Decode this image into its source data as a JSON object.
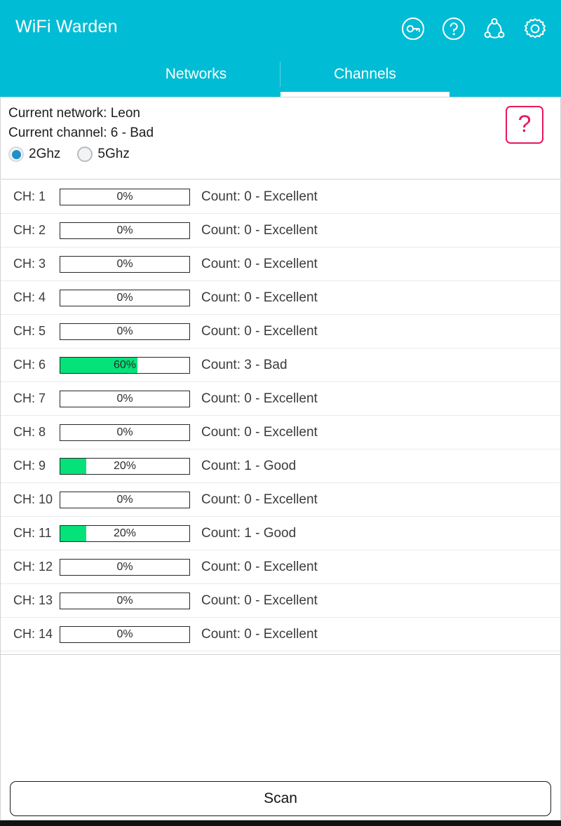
{
  "header": {
    "title": "WiFi Warden",
    "background": "#00bcd4",
    "icons": [
      {
        "name": "key-circle-icon",
        "label": "Passwords"
      },
      {
        "name": "question-circle-icon",
        "label": "Help"
      },
      {
        "name": "network-nodes-icon",
        "label": "Connections"
      },
      {
        "name": "gear-icon",
        "label": "Settings"
      }
    ]
  },
  "tabs": {
    "items": [
      {
        "label": "Networks",
        "active": false
      },
      {
        "label": "Channels",
        "active": true
      }
    ]
  },
  "info": {
    "current_network": "Current network: Leon",
    "current_channel": "Current channel: 6 - Bad",
    "help_glyph": "?",
    "help_color": "#e8195b",
    "bands": [
      {
        "label": "2Ghz",
        "selected": true
      },
      {
        "label": "5Ghz",
        "selected": false
      }
    ]
  },
  "channels": {
    "rows": [
      {
        "label": "CH: 1",
        "percent": "0%",
        "fill": 0,
        "count": "Count: 0 - Excellent"
      },
      {
        "label": "CH: 2",
        "percent": "0%",
        "fill": 0,
        "count": "Count: 0 - Excellent"
      },
      {
        "label": "CH: 3",
        "percent": "0%",
        "fill": 0,
        "count": "Count: 0 - Excellent"
      },
      {
        "label": "CH: 4",
        "percent": "0%",
        "fill": 0,
        "count": "Count: 0 - Excellent"
      },
      {
        "label": "CH: 5",
        "percent": "0%",
        "fill": 0,
        "count": "Count: 0 - Excellent"
      },
      {
        "label": "CH: 6",
        "percent": "60%",
        "fill": 60,
        "count": "Count: 3 - Bad"
      },
      {
        "label": "CH: 7",
        "percent": "0%",
        "fill": 0,
        "count": "Count: 0 - Excellent"
      },
      {
        "label": "CH: 8",
        "percent": "0%",
        "fill": 0,
        "count": "Count: 0 - Excellent"
      },
      {
        "label": "CH: 9",
        "percent": "20%",
        "fill": 20,
        "count": "Count: 1 - Good"
      },
      {
        "label": "CH: 10",
        "percent": "0%",
        "fill": 0,
        "count": "Count: 0 - Excellent"
      },
      {
        "label": "CH: 11",
        "percent": "20%",
        "fill": 20,
        "count": "Count: 1 - Good"
      },
      {
        "label": "CH: 12",
        "percent": "0%",
        "fill": 0,
        "count": "Count: 0 - Excellent"
      },
      {
        "label": "CH: 13",
        "percent": "0%",
        "fill": 0,
        "count": "Count: 0 - Excellent"
      },
      {
        "label": "CH: 14",
        "percent": "0%",
        "fill": 0,
        "count": "Count: 0 - Excellent"
      }
    ],
    "fill_color": "#05e27a"
  },
  "footer": {
    "scan_label": "Scan"
  }
}
